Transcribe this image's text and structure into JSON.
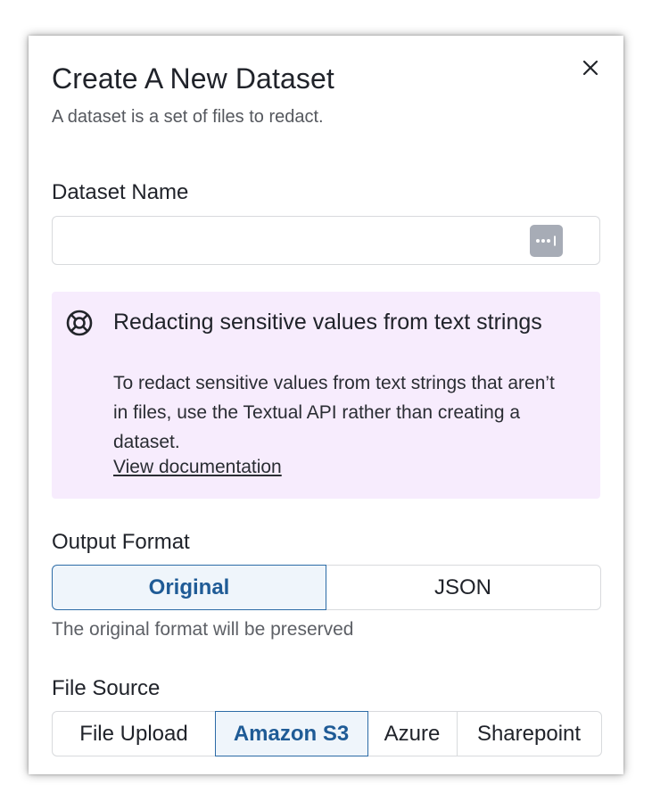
{
  "dialog": {
    "title": "Create A New Dataset",
    "subtitle": "A dataset is a set of files to redact.",
    "close_icon": "close-icon"
  },
  "dataset_name": {
    "label": "Dataset Name",
    "value": "",
    "placeholder": "",
    "icon": "password-manager-icon"
  },
  "callout": {
    "icon": "lifebuoy-icon",
    "title": "Redacting sensitive values from text strings",
    "body": "To redact sensitive values from text strings that aren’t in files, use the Textual API rather than creating a dataset.",
    "link": "View documentation",
    "background": "#f7ecfd"
  },
  "output_format": {
    "label": "Output Format",
    "options": [
      "Original",
      "JSON"
    ],
    "selected": "Original",
    "helper": "The original format will be preserved"
  },
  "file_source": {
    "label": "File Source",
    "options": [
      "File Upload",
      "Amazon S3",
      "Azure",
      "Sharepoint"
    ],
    "selected": "Amazon S3"
  },
  "colors": {
    "accent": "#1f5b96",
    "accent_bg": "#eff5fb"
  }
}
